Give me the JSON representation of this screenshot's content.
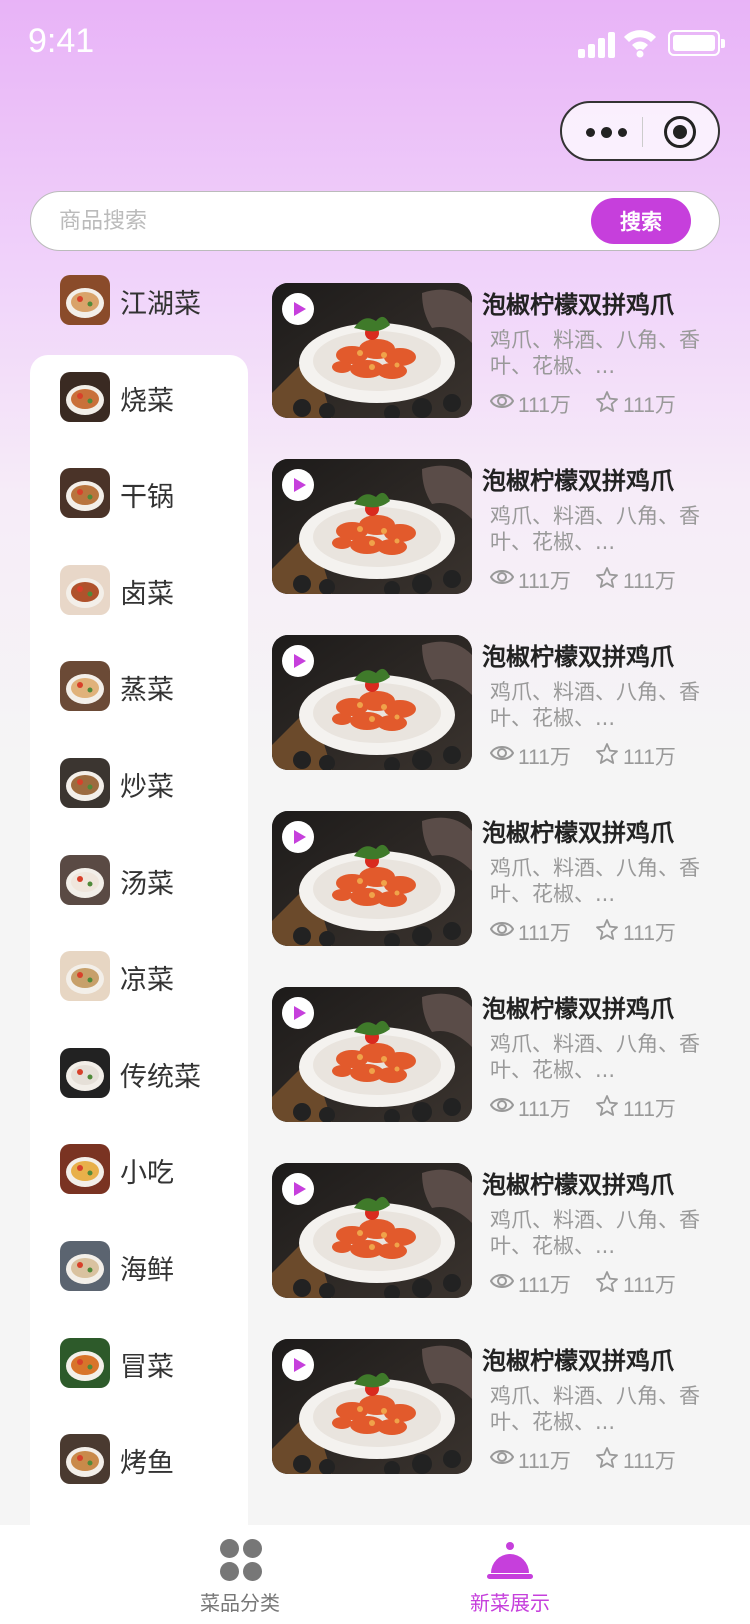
{
  "status_bar": {
    "time": "9:41"
  },
  "search": {
    "placeholder": "商品搜索",
    "button_label": "搜索"
  },
  "sidebar": {
    "items": [
      {
        "label": "江湖菜",
        "thumb": "hotpot"
      },
      {
        "label": "烧菜",
        "thumb": "braise"
      },
      {
        "label": "干锅",
        "thumb": "drypot"
      },
      {
        "label": "卤菜",
        "thumb": "marinated"
      },
      {
        "label": "蒸菜",
        "thumb": "steamed"
      },
      {
        "label": "炒菜",
        "thumb": "stirfry"
      },
      {
        "label": "汤菜",
        "thumb": "soup"
      },
      {
        "label": "凉菜",
        "thumb": "cold"
      },
      {
        "label": "传统菜",
        "thumb": "traditional"
      },
      {
        "label": "小吃",
        "thumb": "snack"
      },
      {
        "label": "海鲜",
        "thumb": "seafood"
      },
      {
        "label": "冒菜",
        "thumb": "maocai"
      },
      {
        "label": "烤鱼",
        "thumb": "grilledfish"
      }
    ],
    "selected_index": 0
  },
  "dishes": [
    {
      "title": "泡椒柠檬双拼鸡爪",
      "desc": "鸡爪、料酒、八角、香叶、花椒、...",
      "views": "111万",
      "favorites": "111万"
    },
    {
      "title": "泡椒柠檬双拼鸡爪",
      "desc": "鸡爪、料酒、八角、香叶、花椒、...",
      "views": "111万",
      "favorites": "111万"
    },
    {
      "title": "泡椒柠檬双拼鸡爪",
      "desc": "鸡爪、料酒、八角、香叶、花椒、...",
      "views": "111万",
      "favorites": "111万"
    },
    {
      "title": "泡椒柠檬双拼鸡爪",
      "desc": "鸡爪、料酒、八角、香叶、花椒、...",
      "views": "111万",
      "favorites": "111万"
    },
    {
      "title": "泡椒柠檬双拼鸡爪",
      "desc": "鸡爪、料酒、八角、香叶、花椒、...",
      "views": "111万",
      "favorites": "111万"
    },
    {
      "title": "泡椒柠檬双拼鸡爪",
      "desc": "鸡爪、料酒、八角、香叶、花椒、...",
      "views": "111万",
      "favorites": "111万"
    },
    {
      "title": "泡椒柠檬双拼鸡爪",
      "desc": "鸡爪、料酒、八角、香叶、花椒、...",
      "views": "111万",
      "favorites": "111万"
    }
  ],
  "tab_bar": {
    "tabs": [
      {
        "label": "菜品分类",
        "icon": "grid-icon",
        "active": false
      },
      {
        "label": "新菜展示",
        "icon": "cloche-icon",
        "active": true
      }
    ]
  },
  "colors": {
    "accent": "#c63fdc",
    "gradient_top": "#e8b3f7",
    "inactive_tab": "#777777",
    "muted_text": "#999999"
  }
}
